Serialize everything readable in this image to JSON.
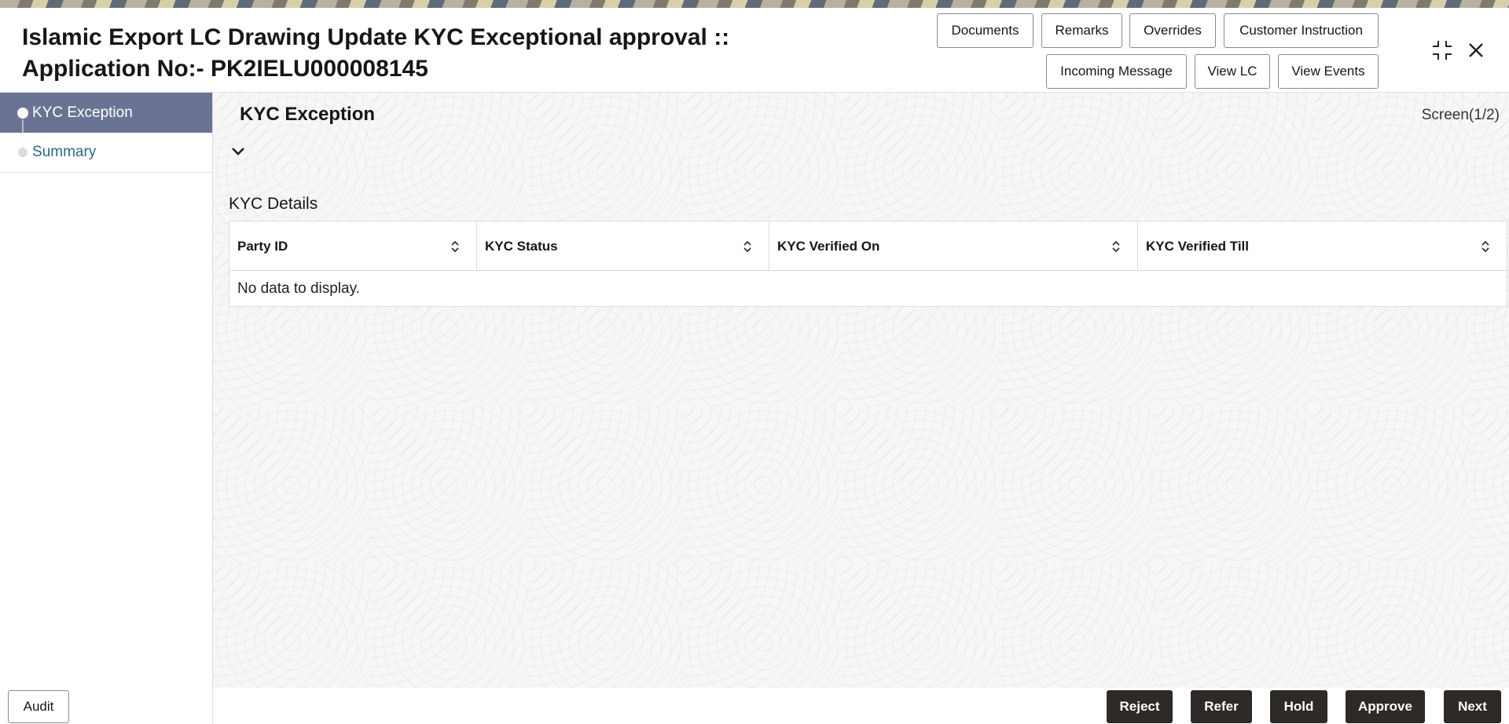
{
  "header": {
    "title_line1": "Islamic Export LC Drawing Update KYC Exceptional approval ::",
    "title_line2": "Application No:- PK2IELU000008145",
    "buttons": {
      "documents": "Documents",
      "remarks": "Remarks",
      "overrides": "Overrides",
      "customer_instruction": "Customer Instruction",
      "incoming_message": "Incoming Message",
      "view_lc": "View LC",
      "view_events": "View Events"
    },
    "icons": {
      "minimize": "collapse-icon",
      "close": "close-icon"
    }
  },
  "sidebar": {
    "items": [
      {
        "label": "KYC Exception",
        "active": true
      },
      {
        "label": "Summary",
        "active": false
      }
    ]
  },
  "main": {
    "section_title": "KYC Exception",
    "screen_indicator": "Screen(1/2)",
    "kyc_details": {
      "heading": "KYC Details",
      "columns": [
        "Party ID",
        "KYC Status",
        "KYC Verified On",
        "KYC Verified Till"
      ],
      "empty_message": "No data to display."
    }
  },
  "footer": {
    "audit": "Audit",
    "reject": "Reject",
    "refer": "Refer",
    "hold": "Hold",
    "approve": "Approve",
    "next": "Next"
  },
  "colors": {
    "sidebar_active": "#6a7393",
    "sidebar_link": "#2a6b82",
    "footer_button": "#2e2a27"
  }
}
